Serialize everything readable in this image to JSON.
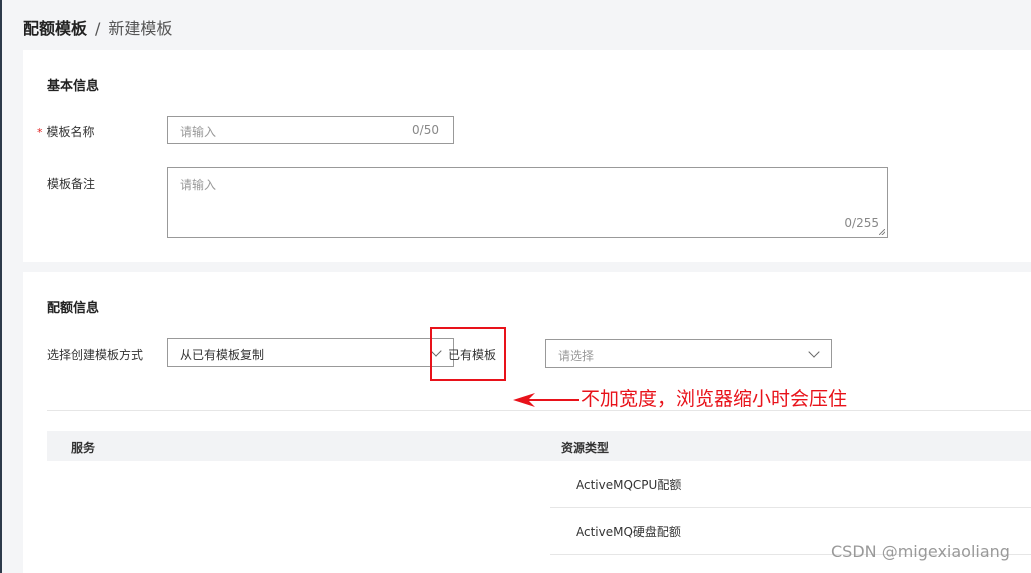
{
  "breadcrumb": {
    "current": "配额模板",
    "separator": "/",
    "page": "新建模板"
  },
  "basic_info": {
    "title": "基本信息",
    "name_field": {
      "required_mark": "*",
      "label": "模板名称",
      "placeholder": "请输入",
      "count": "0/50"
    },
    "remark_field": {
      "label": "模板备注",
      "placeholder": "请输入",
      "count": "0/255"
    }
  },
  "quota_info": {
    "title": "配额信息",
    "method_label": "选择创建模板方式",
    "method_select": {
      "value": "从已有模板复制",
      "icon": "chevron-down-icon"
    },
    "existing_label": "已有模板",
    "template_select": {
      "placeholder": "请选择",
      "icon": "chevron-down-icon"
    },
    "table": {
      "headers": [
        "服务",
        "资源类型"
      ],
      "rows": [
        "ActiveMQCPU配额",
        "ActiveMQ硬盘配额"
      ]
    }
  },
  "annotation": {
    "text": "不加宽度，浏览器缩小时会压住",
    "color": "#e8121a"
  },
  "watermark": "CSDN @migexiaoliang"
}
